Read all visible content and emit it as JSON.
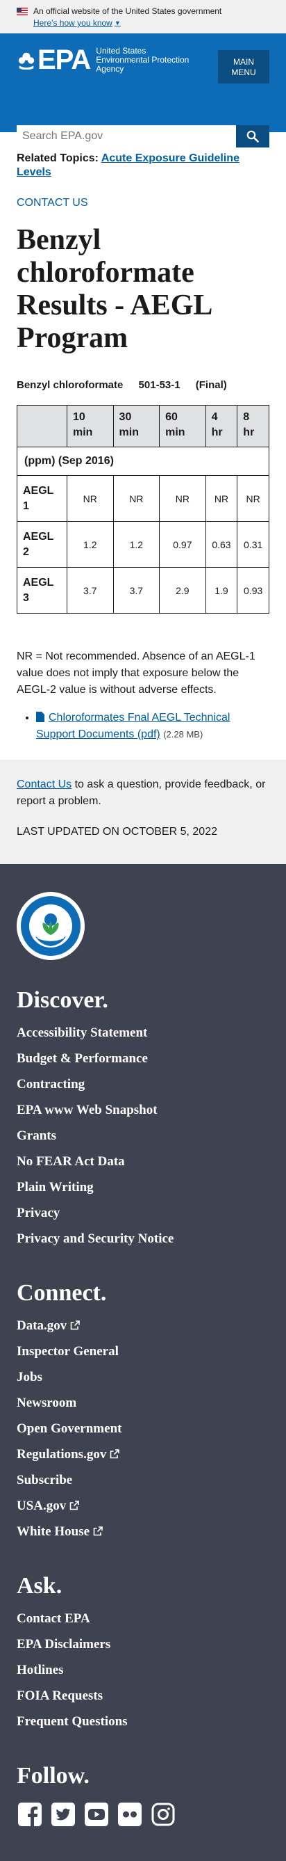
{
  "gov_banner": {
    "text": "An official website of the United States government",
    "link": "Here’s how you know"
  },
  "header": {
    "logo_mark": "EPA",
    "logo_line1": "United States",
    "logo_line2": "Environmental Protection",
    "logo_line3": "Agency",
    "menu_line1": "MAIN",
    "menu_line2": "MENU",
    "search_placeholder": "Search EPA.gov"
  },
  "main": {
    "related_label": "Related Topics:",
    "related_link": "Acute Exposure Guideline Levels",
    "contact_us": "CONTACT US",
    "title": "Benzyl chloroformate Results - AEGL Program",
    "chemical": "Benzyl chloroformate",
    "cas": "501-53-1",
    "status": "(Final)",
    "table": {
      "headers": [
        "",
        "10 min",
        "30 min",
        "60 min",
        "4 hr",
        "8 hr"
      ],
      "unit_row": "(ppm) (Sep 2016)",
      "rows": [
        {
          "label": "AEGL 1",
          "values": [
            "NR",
            "NR",
            "NR",
            "NR",
            "NR"
          ]
        },
        {
          "label": "AEGL 2",
          "values": [
            "1.2",
            "1.2",
            "0.97",
            "0.63",
            "0.31"
          ]
        },
        {
          "label": "AEGL 3",
          "values": [
            "3.7",
            "3.7",
            "2.9",
            "1.9",
            "0.93"
          ]
        }
      ]
    },
    "note": "NR = Not recommended.  Absence of an AEGL-1 value does not imply that exposure below the AEGL-2 value is without adverse effects.",
    "doc_link": "Chloroformates Fnal AEGL Technical Support Documents (pdf)",
    "doc_size": "(2.28 MB)"
  },
  "page_footer": {
    "contact_link": "Contact Us",
    "contact_text": " to ask a question, provide feedback, or report a problem.",
    "updated": "LAST UPDATED ON OCTOBER 5, 2022"
  },
  "site_footer": {
    "discover_heading": "Discover.",
    "discover_links": [
      "Accessibility Statement",
      "Budget & Performance",
      "Contracting",
      "EPA www Web Snapshot",
      "Grants",
      "No FEAR Act Data",
      "Plain Writing",
      "Privacy",
      "Privacy and Security Notice"
    ],
    "connect_heading": "Connect.",
    "connect_links": [
      {
        "label": "Data.gov",
        "external": true
      },
      {
        "label": "Inspector General",
        "external": false
      },
      {
        "label": "Jobs",
        "external": false
      },
      {
        "label": "Newsroom",
        "external": false
      },
      {
        "label": "Open Government",
        "external": false
      },
      {
        "label": "Regulations.gov",
        "external": true
      },
      {
        "label": "Subscribe",
        "external": false
      },
      {
        "label": "USA.gov",
        "external": true
      },
      {
        "label": "White House",
        "external": true
      }
    ],
    "ask_heading": "Ask.",
    "ask_links": [
      "Contact EPA",
      "EPA Disclaimers",
      "Hotlines",
      "FOIA Requests",
      "Frequent Questions"
    ],
    "follow_heading": "Follow.",
    "social_icons": [
      "facebook-icon",
      "twitter-icon",
      "youtube-icon",
      "flickr-icon",
      "instagram-icon"
    ]
  }
}
